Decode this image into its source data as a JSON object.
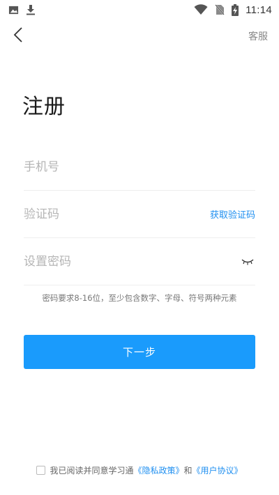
{
  "status_bar": {
    "time": "11:14",
    "left_icons": [
      "image-icon",
      "download-icon"
    ],
    "right_icons": [
      "wifi-icon",
      "no-sim-icon",
      "battery-charging-icon"
    ]
  },
  "nav": {
    "back_icon": "chevron-left-icon",
    "service_label": "客服"
  },
  "page": {
    "title": "注册"
  },
  "form": {
    "phone_placeholder": "手机号",
    "phone_value": "",
    "code_placeholder": "验证码",
    "code_value": "",
    "get_code_label": "获取验证码",
    "password_placeholder": "设置密码",
    "password_value": "",
    "password_hint": "密码要求8-16位，至少包含数字、字母、符号两种元素"
  },
  "actions": {
    "next_label": "下一步"
  },
  "agreement": {
    "checked": false,
    "prefix": "我已阅读并同意学习通",
    "privacy_link": "《隐私政策》",
    "conjunction": "和",
    "terms_link": "《用户协议》"
  },
  "colors": {
    "accent": "#1a9bfc",
    "link": "#1f8ff0"
  }
}
